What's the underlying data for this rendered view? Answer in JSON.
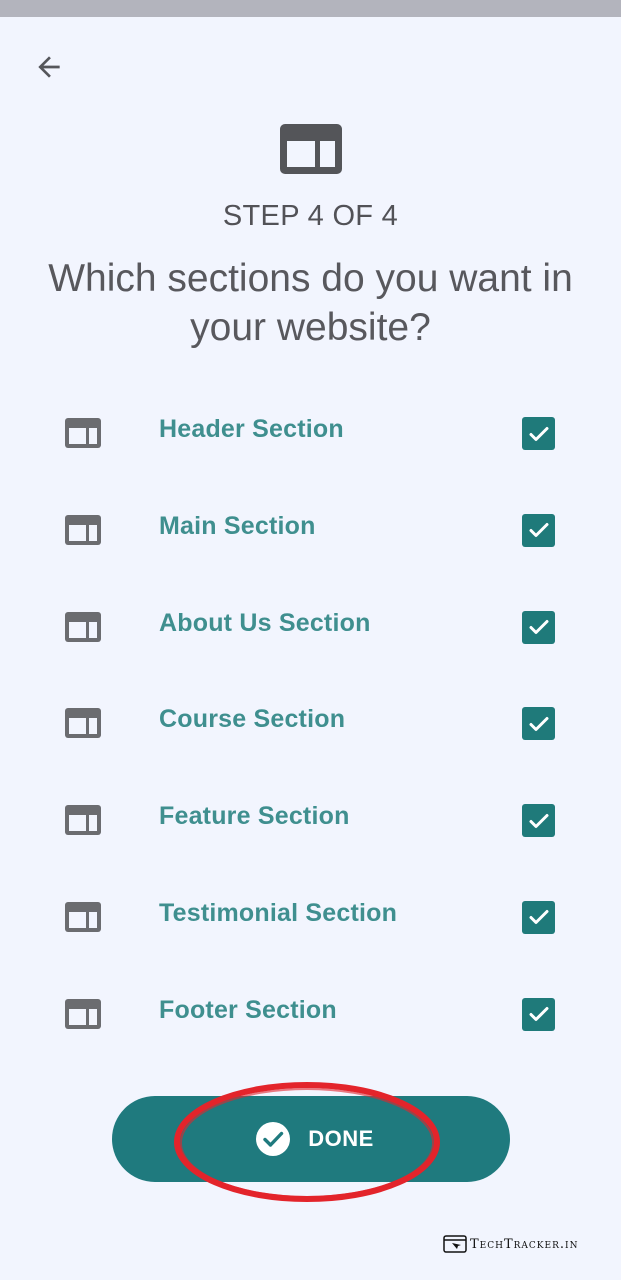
{
  "header": {
    "back_icon": "arrow-back-icon",
    "hero_icon": "web-layout-icon"
  },
  "wizard": {
    "step_label": "STEP 4 OF 4",
    "question": "Which sections do you want in your website?"
  },
  "sections": [
    {
      "label": "Header Section",
      "checked": true
    },
    {
      "label": "Main Section",
      "checked": true
    },
    {
      "label": "About Us Section",
      "checked": true
    },
    {
      "label": "Course Section",
      "checked": true
    },
    {
      "label": "Feature Section",
      "checked": true
    },
    {
      "label": "Testimonial Section",
      "checked": true
    },
    {
      "label": "Footer Section",
      "checked": true
    }
  ],
  "done_button": {
    "label": "DONE",
    "icon": "check-circle-icon"
  },
  "watermark": {
    "text": "TechTracker.in"
  },
  "colors": {
    "background": "#f2f5fe",
    "accent": "#1f7a7e",
    "label_teal": "#3f8f8f",
    "annotation_red": "#e3242b"
  }
}
